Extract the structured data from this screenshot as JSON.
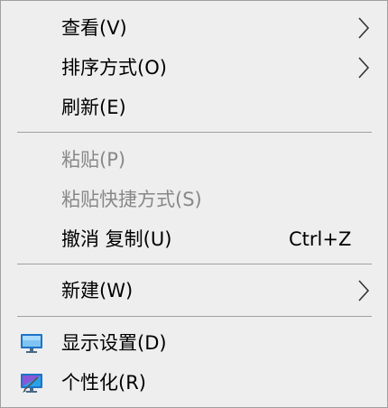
{
  "menu": {
    "view": {
      "label": "查看(V)",
      "icon": "chevron-right-icon"
    },
    "sort_by": {
      "label": "排序方式(O)",
      "icon": "chevron-right-icon"
    },
    "refresh": {
      "label": "刷新(E)"
    },
    "paste": {
      "label": "粘贴(P)",
      "enabled": false
    },
    "paste_shortcut": {
      "label": "粘贴快捷方式(S)",
      "enabled": false
    },
    "undo_copy": {
      "label": "撤消 复制(U)",
      "shortcut": "Ctrl+Z"
    },
    "new": {
      "label": "新建(W)",
      "icon": "chevron-right-icon"
    },
    "display_settings": {
      "label": "显示设置(D)",
      "icon": "monitor-icon"
    },
    "personalize": {
      "label": "个性化(R)",
      "icon": "personalize-icon"
    }
  },
  "colors": {
    "menu_background": "#eeeeee",
    "menu_border": "#a0a0a0",
    "disabled_text": "#888888",
    "text": "#000000"
  }
}
